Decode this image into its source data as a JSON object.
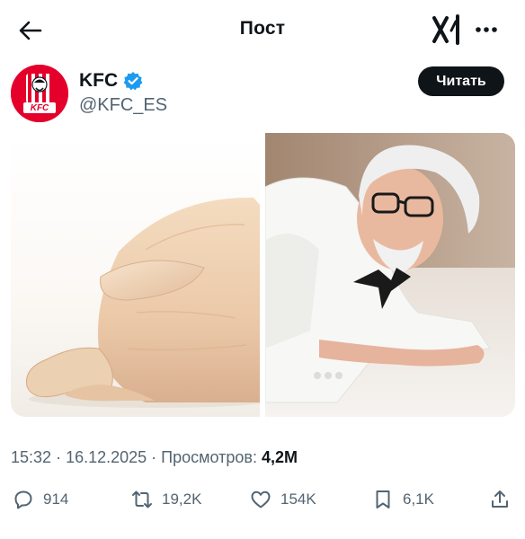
{
  "header": {
    "title": "Пост"
  },
  "author": {
    "name": "KFC",
    "handle": "@KFC_ES",
    "avatar_text": "KFC"
  },
  "follow_button": {
    "label": "Читать"
  },
  "media": {
    "image_count": 2
  },
  "post_meta": {
    "time": "15:32",
    "date": "16.12.2025",
    "views_label": "Просмотров:",
    "views_value": "4,2M"
  },
  "actions": {
    "replies": "914",
    "reposts": "19,2K",
    "likes": "154K",
    "bookmarks": "6,1K"
  },
  "colors": {
    "text": "#0f1419",
    "muted": "#536471",
    "brand_red": "#e4002b",
    "verified_blue": "#1d9bf0",
    "button_bg": "#0f1419"
  }
}
